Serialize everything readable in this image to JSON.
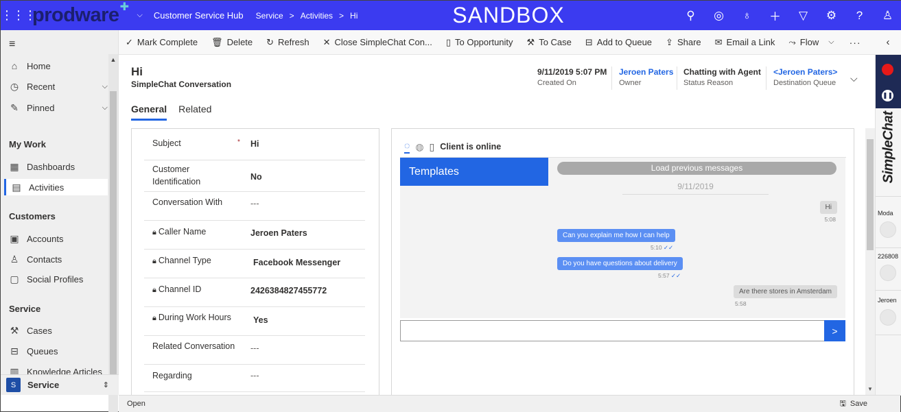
{
  "topbar": {
    "logo": "prodware",
    "app_name": "Customer Service Hub",
    "breadcrumbs": [
      "Service",
      "Activities",
      "Hi"
    ],
    "environment": "SANDBOX"
  },
  "nav": {
    "items_top": [
      {
        "label": "Home",
        "icon": "home-icon"
      },
      {
        "label": "Recent",
        "icon": "clock-icon"
      },
      {
        "label": "Pinned",
        "icon": "pin-icon"
      }
    ],
    "groups": [
      {
        "title": "My Work",
        "items": [
          "Dashboards",
          "Activities"
        ]
      },
      {
        "title": "Customers",
        "items": [
          "Accounts",
          "Contacts",
          "Social Profiles"
        ]
      },
      {
        "title": "Service",
        "items": [
          "Cases",
          "Queues",
          "Knowledge Articles"
        ]
      }
    ],
    "active": "Activities",
    "area_initial": "S",
    "area_label": "Service"
  },
  "commands": [
    "Mark Complete",
    "Delete",
    "Refresh",
    "Close SimpleChat Con...",
    "To Opportunity",
    "To Case",
    "Add to Queue",
    "Share",
    "Email a Link",
    "Flow"
  ],
  "header": {
    "title": "Hi",
    "subtitle": "SimpleChat Conversation",
    "fields": [
      {
        "value": "9/11/2019 5:07 PM",
        "label": "Created On"
      },
      {
        "value": "Jeroen Paters",
        "label": "Owner"
      },
      {
        "value": "Chatting with Agent",
        "label": "Status Reason"
      },
      {
        "value": "<Jeroen Paters>",
        "label": "Destination Queue"
      }
    ]
  },
  "tabs": [
    "General",
    "Related"
  ],
  "fields": [
    {
      "label": "Subject",
      "value": "Hi",
      "required": "*"
    },
    {
      "label": "Customer Identification",
      "value": "No"
    },
    {
      "label": "Conversation With",
      "value": "---"
    },
    {
      "label": "Caller Name",
      "value": "Jeroen Paters"
    },
    {
      "label": "Channel Type",
      "value": "Facebook Messenger"
    },
    {
      "label": "Channel ID",
      "value": "2426384827455772"
    },
    {
      "label": "During Work Hours",
      "value": "Yes"
    },
    {
      "label": "Related Conversation",
      "value": "---"
    },
    {
      "label": "Regarding",
      "value": "---"
    }
  ],
  "chat": {
    "status": "Client is online",
    "templates_label": "Templates",
    "load_previous": "Load previous messages",
    "date": "9/11/2019",
    "messages": [
      {
        "text": "Hi",
        "time": "5:08",
        "dir": "in"
      },
      {
        "text": "Can you explain me how I can help",
        "time": "5:10",
        "dir": "out"
      },
      {
        "text": "Do you have questions about delivery",
        "time": "5:57",
        "dir": "out"
      },
      {
        "text": "Are there stores in Amsterdam",
        "time": "5:58",
        "dir": "in"
      }
    ],
    "send_label": ">"
  },
  "rail": {
    "brand": "SimpleChat",
    "entries": [
      "Moda",
      "226808",
      "Jeroen"
    ]
  },
  "footer": {
    "status": "Open",
    "save_label": "Save"
  }
}
